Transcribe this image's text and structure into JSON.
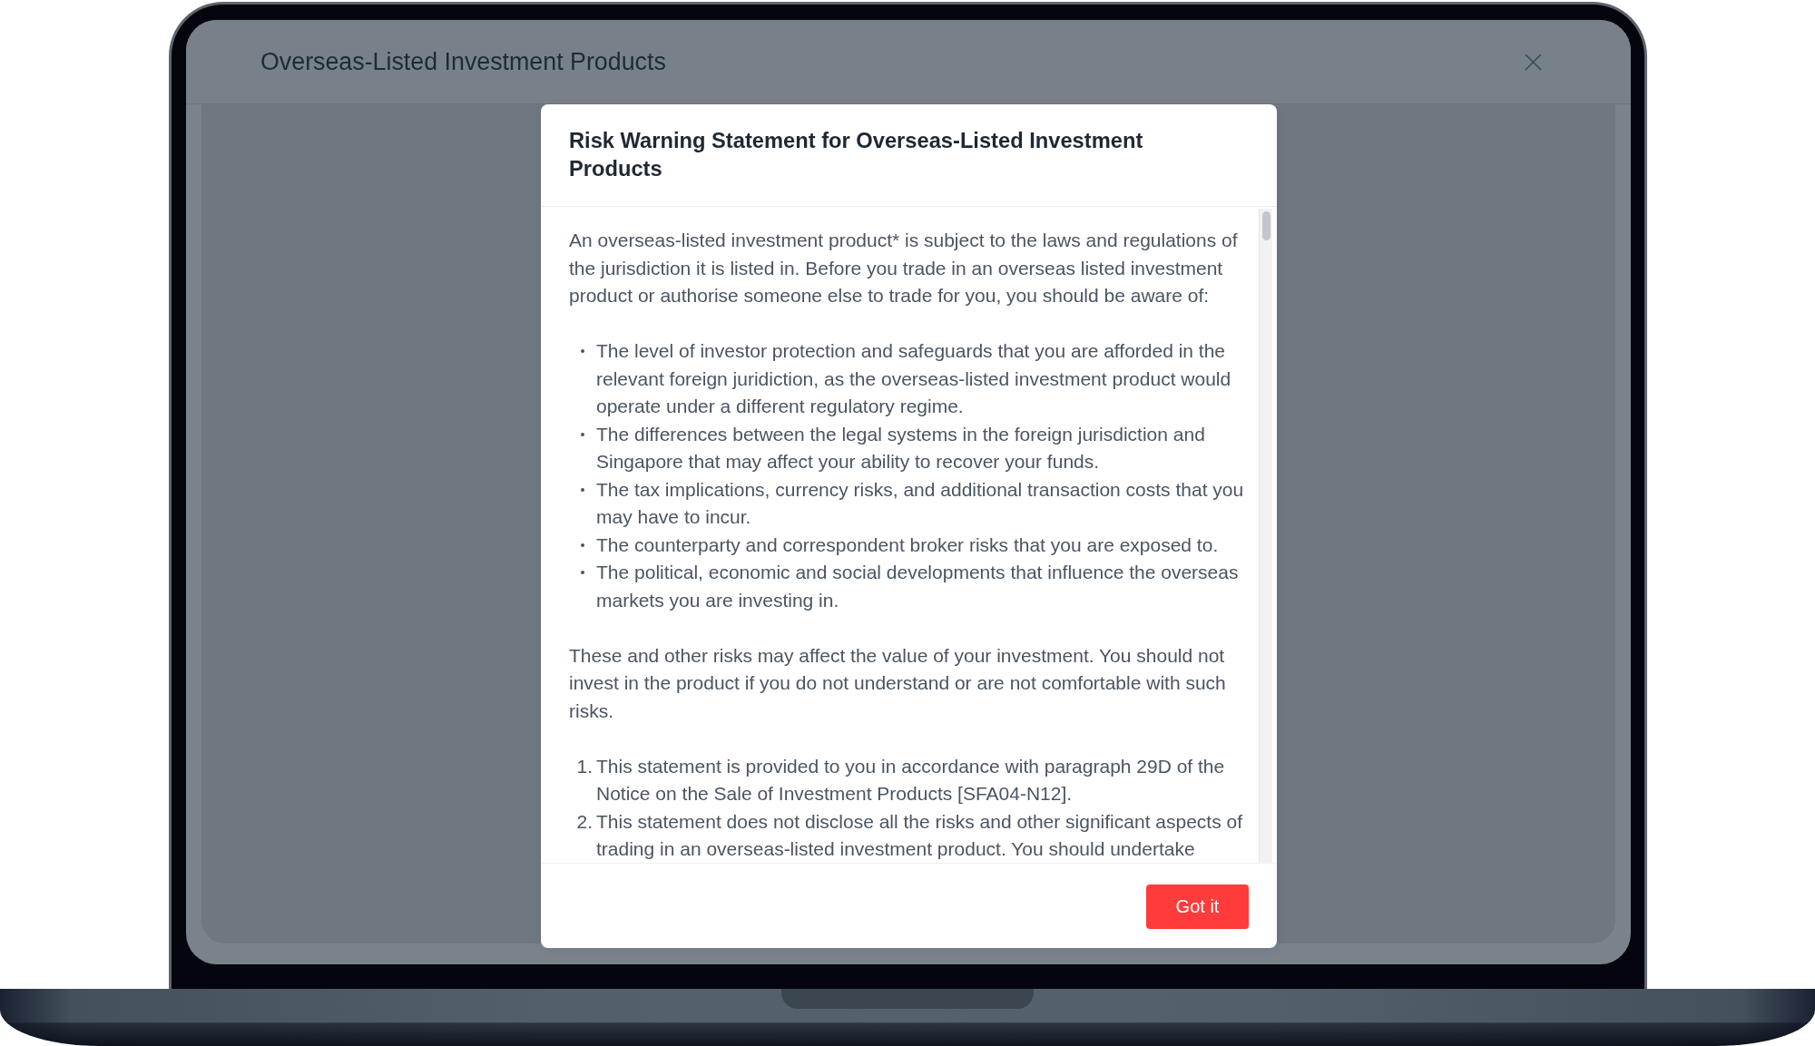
{
  "window": {
    "title": "Overseas-Listed Investment Products"
  },
  "dialog": {
    "title": "Risk Warning Statement for Overseas-Listed Investment Products",
    "body": [
      {
        "kind": "paragraph",
        "text": "An overseas-listed investment product* is subject to the laws and regulations of the jurisdiction it is listed in. Before you trade in an overseas listed investment product or authorise someone else to trade for you, you should be aware of:"
      },
      {
        "kind": "bullets",
        "items": [
          "The level of investor protection and safeguards that you are afforded in the relevant foreign juridiction, as the overseas-listed investment product would operate under a different regulatory regime.",
          "The differences between the legal systems in the foreign jurisdiction and Singapore that may affect your ability to recover your funds.",
          "The tax implications, currency risks, and additional transaction costs that you may have to incur.",
          "The counterparty and correspondent broker risks that you are exposed to.",
          "The political, economic and social developments that influence the overseas markets you are investing in."
        ]
      },
      {
        "kind": "paragraph",
        "text": "These and other risks may affect the value of your investment. You should not invest in the product if you do not understand or are not comfortable with such risks."
      },
      {
        "kind": "numbered",
        "items": [
          {
            "number": "1.",
            "text": "This statement is provided to you in accordance with paragraph 29D of the Notice on the Sale of Investment Products [SFA04-N12]."
          },
          {
            "number": "2.",
            "text": "This statement does not disclose all the risks and other significant aspects of trading in an overseas-listed investment product. You should undertake"
          }
        ]
      }
    ],
    "button": {
      "label": "Got it"
    }
  }
}
